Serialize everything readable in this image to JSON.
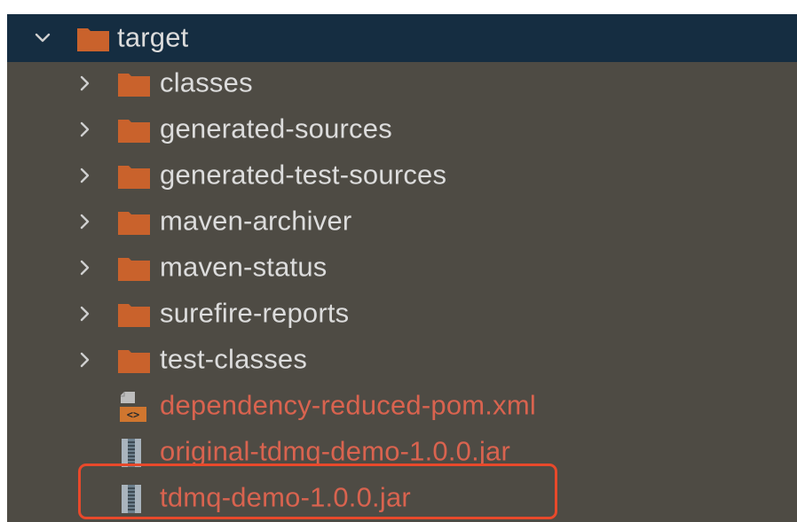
{
  "tree": {
    "root": {
      "label": "target",
      "expanded": true
    },
    "folders": [
      {
        "label": "classes"
      },
      {
        "label": "generated-sources"
      },
      {
        "label": "generated-test-sources"
      },
      {
        "label": "maven-archiver"
      },
      {
        "label": "maven-status"
      },
      {
        "label": "surefire-reports"
      },
      {
        "label": "test-classes"
      }
    ],
    "files": [
      {
        "label": "dependency-reduced-pom.xml",
        "icon": "xml-file-icon"
      },
      {
        "label": "original-tdmq-demo-1.0.0.jar",
        "icon": "jar-file-icon"
      },
      {
        "label": "tdmq-demo-1.0.0.jar",
        "icon": "jar-file-icon",
        "highlighted": true
      }
    ]
  },
  "colors": {
    "panel_bg": "#4e4b44",
    "selected_bg": "#152d41",
    "folder": "#c9622c",
    "text": "#dcdcdc",
    "unversioned_text": "#d9634f",
    "highlight_border": "#e8492b"
  }
}
